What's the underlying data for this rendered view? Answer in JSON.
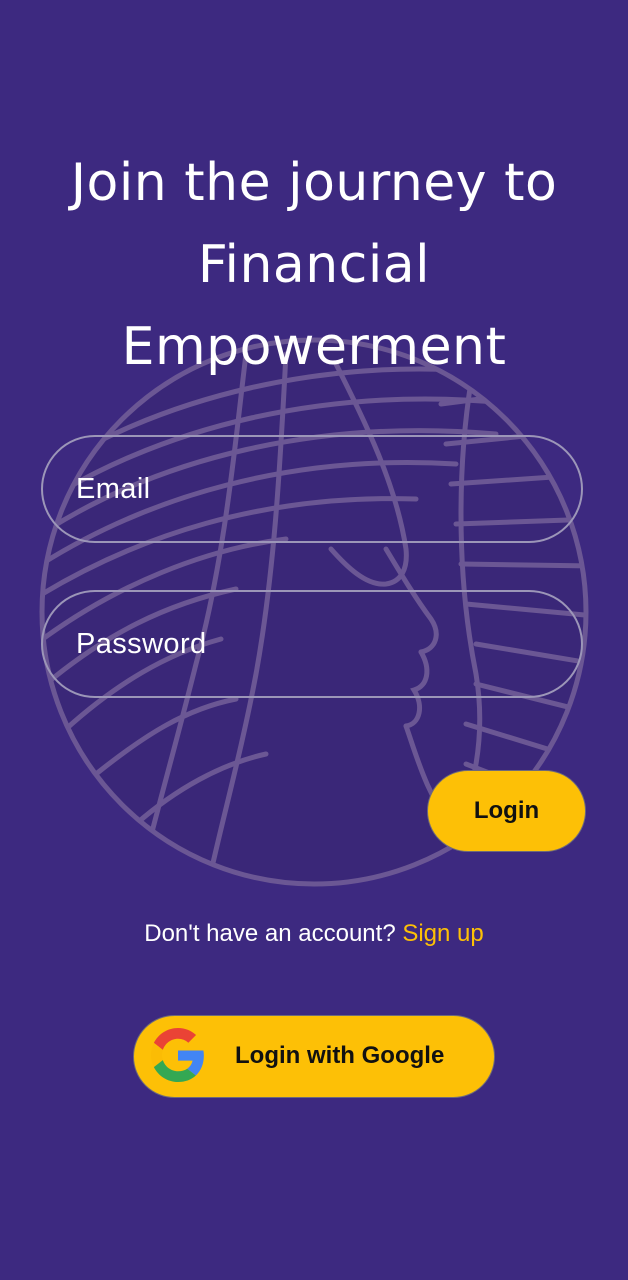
{
  "colors": {
    "background": "#3d2980",
    "accent": "#fdc006",
    "field_border": "#9c96b8",
    "text": "#ffffff"
  },
  "headline": {
    "line1": "Join the journey to",
    "line2": "Financial",
    "line3": "Empowerment"
  },
  "form": {
    "email_placeholder": "Email",
    "password_placeholder": "Password",
    "login_label": "Login"
  },
  "signup": {
    "prompt": "Don't have an account?",
    "link": "Sign up"
  },
  "google": {
    "label": "Login with Google",
    "icon": "google-icon"
  },
  "background_logo": {
    "icon": "woman-profile-logo-icon"
  }
}
